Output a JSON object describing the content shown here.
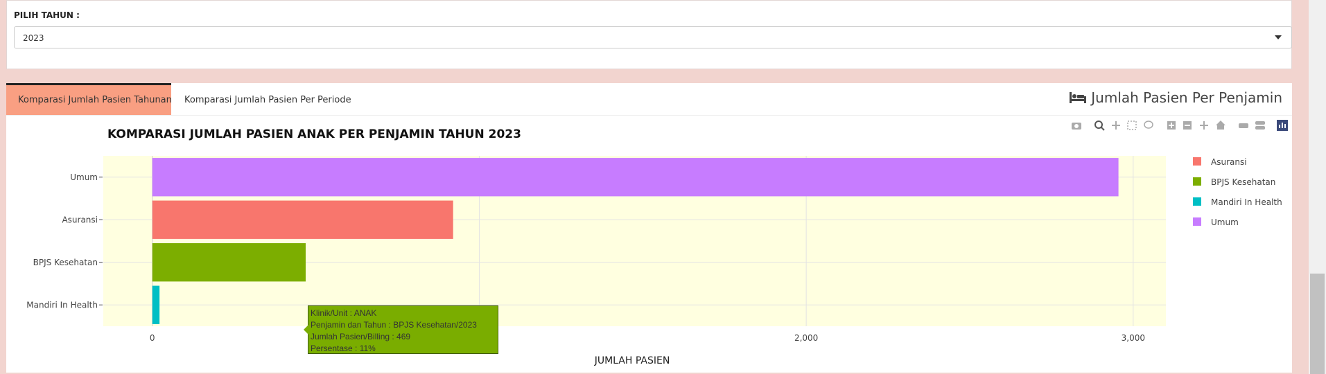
{
  "year_filter": {
    "label": "PILIH TAHUN :",
    "selected": "2023"
  },
  "tabs": [
    {
      "label": "Komparasi Jumlah Pasien Tahunan",
      "active": true
    },
    {
      "label": "Komparasi Jumlah Pasien Per Periode",
      "active": false
    }
  ],
  "box_title": "Jumlah Pasien Per Penjamin",
  "modebar_icons": [
    "camera-icon",
    "zoom-icon",
    "pan-icon",
    "box-select-icon",
    "lasso-icon",
    "zoom-in-icon",
    "zoom-out-icon",
    "autoscale-icon",
    "reset-axes-icon",
    "spike-lines-icon",
    "compare-hover-icon",
    "plotly-logo-icon"
  ],
  "chart_data": {
    "type": "bar",
    "orientation": "horizontal",
    "title": "KOMPARASI JUMLAH PASIEN ANAK PER PENJAMIN TAHUN 2023",
    "xlabel": "JUMLAH PASIEN",
    "ylabel": "",
    "xlim": [
      -150,
      3100
    ],
    "x_ticks": [
      0,
      1000,
      2000,
      3000
    ],
    "x_tick_labels": [
      "0",
      "1,000",
      "2,000",
      "3,000"
    ],
    "categories": [
      "Umum",
      "Asuransi",
      "BPJS Kesehatan",
      "Mandiri In Health"
    ],
    "series": [
      {
        "name": "Asuransi",
        "category": "Asuransi",
        "value": 920,
        "color": "#f8766d"
      },
      {
        "name": "BPJS Kesehatan",
        "category": "BPJS Kesehatan",
        "value": 469,
        "color": "#7cae00"
      },
      {
        "name": "Mandiri In Health",
        "category": "Mandiri In Health",
        "value": 22,
        "color": "#00bfc4"
      },
      {
        "name": "Umum",
        "category": "Umum",
        "value": 2955,
        "color": "#c77cff"
      }
    ],
    "plot_background": "#ffffe0",
    "grid": true,
    "legend_position": "right"
  },
  "tooltip": {
    "lines": [
      "Klinik/Unit : ANAK",
      "Penjamin dan Tahun : BPJS Kesehatan/2023",
      "Jumlah Pasien/Billing : 469",
      "Persentase : 11%"
    ]
  }
}
